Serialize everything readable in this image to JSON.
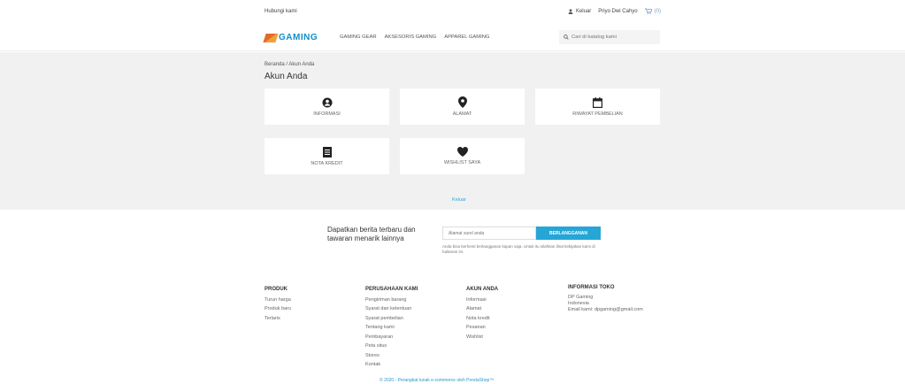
{
  "topbar": {
    "contact": "Hubungi kami",
    "logout": "Keluar",
    "user": "Priyo Dwi Cahyo",
    "cart": "(0)"
  },
  "brand": {
    "logo": "GAMING"
  },
  "menu": [
    "GAMING GEAR",
    "AKSESORIS GAMING",
    "APPAREL GAMING"
  ],
  "search": {
    "placeholder": "Cari di katalog kami"
  },
  "breadcrumb": "Beranda / Akun Anda",
  "page_title": "Akun Anda",
  "tiles": [
    {
      "label": "INFORMASI",
      "icon": "user-circle-icon"
    },
    {
      "label": "ALAMAT",
      "icon": "location-pin-icon"
    },
    {
      "label": "RIWAYAT PEMBELIAN",
      "icon": "calendar-icon"
    },
    {
      "label": "NOTA KREDIT",
      "icon": "document-icon"
    },
    {
      "label": "WISHLIST SAYA",
      "icon": "heart-icon"
    }
  ],
  "logout_link": "Keluar",
  "newsletter": {
    "heading": "Dapatkan berita terbaru dan tawaran menarik lainnya",
    "email_placeholder": "Alamat surel anda",
    "button": "BERLANGGANAN",
    "note": "Anda bisa berhenti berlangganan kapan saja. Untuk itu silahkan lihat kebijakan kami di halaman ini."
  },
  "footer": {
    "columns": [
      {
        "title": "PRODUK",
        "items": [
          "Turun harga",
          "Produk baru",
          "Terlaris"
        ]
      },
      {
        "title": "PERUSAHAAN KAMI",
        "items": [
          "Pengiriman barang",
          "Syarat dan ketentuan",
          "Syarat pembelian",
          "Tentang kami",
          "Pembayaran",
          "Peta situs",
          "Stores",
          "Kontak"
        ]
      },
      {
        "title": "AKUN ANDA",
        "items": [
          "Informasi",
          "Alamat",
          "Nota kredit",
          "Pesanan",
          "Wishlist"
        ]
      },
      {
        "title": "INFORMASI TOKO",
        "items": [
          "DP Gaming",
          "Indonesia",
          "Email kami: dpgaming@gmail.com"
        ]
      }
    ],
    "copyright": "© 2020 - Perangkat lunak e-commerce oleh PrestaShop™"
  }
}
